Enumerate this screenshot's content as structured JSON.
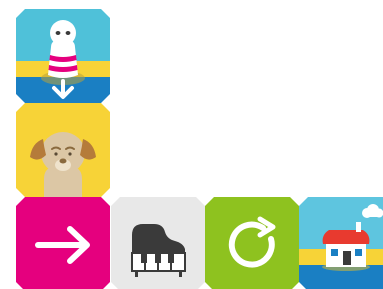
{
  "program": {
    "blocks": [
      {
        "type": "start-character",
        "icon": "character-start-icon",
        "color": "#4fc1d9"
      },
      {
        "type": "dog",
        "icon": "dog-icon",
        "color": "#f7d337"
      },
      {
        "type": "move-right",
        "icon": "arrow-right-icon",
        "color": "#e5007e"
      },
      {
        "type": "piano",
        "icon": "piano-icon",
        "color": "#e8e8e8"
      },
      {
        "type": "repeat",
        "icon": "loop-icon",
        "color": "#8ec21f"
      },
      {
        "type": "go-home",
        "icon": "house-icon",
        "color": "#5ec5df"
      }
    ]
  },
  "colors": {
    "sky": "#4fc1d9",
    "sand": "#f7d337",
    "ocean": "#1a7fc3",
    "magenta": "#e5007e",
    "green": "#8ec21f",
    "grey": "#e8e8e8",
    "red": "#e83a2f"
  }
}
